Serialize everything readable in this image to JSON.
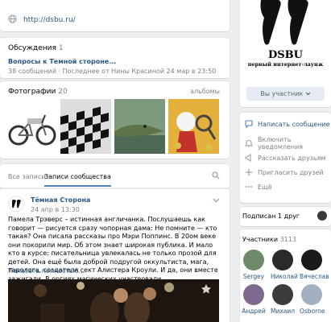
{
  "link": {
    "url": "http://dsbu.ru/"
  },
  "discussions": {
    "title": "Обсуждения",
    "count": "1",
    "topic": "Вопросы к Темной стороне...",
    "meta": "38 сообщений · Последнее от Нины Красиной 24 мар в 23:50"
  },
  "photos": {
    "title": "Фотографии",
    "count": "20",
    "albums_label": "альбомы"
  },
  "tabs": {
    "all_posts": "Все записи",
    "community_posts": "Записи сообщества"
  },
  "post": {
    "author": "Тёмная Сторона",
    "date": "24 апр в 13:30",
    "text": "Памела Трэверс – истинная англичанка. Послушаешь как говорит — рисуется сразу чопорная дама: Не помните — кто такая? Она писала рассказы про Мэри Поппинс. В 20ом веке они покорили мир. Об этом знает широкая публика. И мало кто в курсе: писательница увлекалась не только прозой для детей. Она ещё была доброй подругой оккультиста, мага, таролога, создателя сект Алистера Кроули. И да, они вместе зажигали. В оргиях магических участвовали.",
    "more": "Показать полностью..."
  },
  "cover": {
    "brand": "DSBU",
    "slogan": "первый интернет-лаунж",
    "member_button": "Вы участник"
  },
  "menu": [
    {
      "label": "Написать сообщение",
      "icon": "message-icon",
      "link": true
    },
    {
      "label": "Включить уведомления",
      "icon": "bell-icon",
      "link": false
    },
    {
      "label": "Рассказать друзьям",
      "icon": "megaphone-icon",
      "link": false
    },
    {
      "label": "Пригласить друзей",
      "icon": "add-user-icon",
      "link": false
    },
    {
      "label": "Ещё",
      "icon": "more-icon",
      "link": false
    }
  ],
  "subscribed": {
    "text": "Подписан 1 друг"
  },
  "members": {
    "title": "Участники",
    "count": "3113",
    "list": [
      {
        "name": "Sergey",
        "color": "#6f8a6a"
      },
      {
        "name": "Николай",
        "color": "#2a2a2a"
      },
      {
        "name": "Вячеслав",
        "color": "#1b1b1b"
      },
      {
        "name": "Андрей",
        "color": "#7d6a8c"
      },
      {
        "name": "Михаил",
        "color": "#3b3a3c"
      },
      {
        "name": "Osborne",
        "color": "#a3b0c2"
      }
    ]
  },
  "colors": {
    "accent": "#5181b8",
    "link": "#2a5885",
    "background": "#edeef0"
  }
}
